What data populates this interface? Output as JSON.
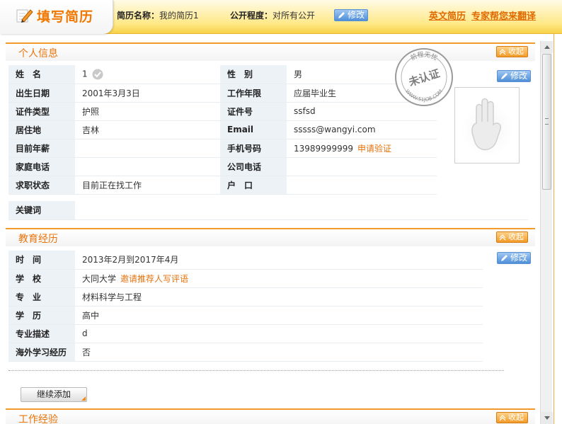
{
  "header": {
    "title": "填写简历",
    "resume_name_label": "简历名称：",
    "resume_name_value": "我的简历1",
    "privacy_label": "公开程度：",
    "privacy_value": "对所有公开",
    "edit_label": "修改",
    "english_resume_link": "英文简历",
    "translate_link": "专家帮您来翻译"
  },
  "personal": {
    "title": "个人信息",
    "collapse_label": "收起",
    "edit_label": "修改",
    "stamp_text_top": "前程无忧",
    "stamp_text_mid": "未认证",
    "stamp_text_bottom": "WWW.51JOB.COM",
    "rows": [
      {
        "l1": "姓　名",
        "v1": "1",
        "l2": "性　别",
        "v2": "男"
      },
      {
        "l1": "出生日期",
        "v1": "2001年3月3日",
        "l2": "工作年限",
        "v2": "应届毕业生"
      },
      {
        "l1": "证件类型",
        "v1": "护照",
        "l2": "证件号",
        "v2": "ssfsd"
      },
      {
        "l1": "居住地",
        "v1": " 吉林",
        "l2": "Email",
        "v2": "sssss@wangyi.com"
      },
      {
        "l1": "目前年薪",
        "v1": "",
        "l2": "手机号码",
        "v2": "13989999999",
        "v2_link": "申请验证"
      },
      {
        "l1": "家庭电话",
        "v1": "",
        "l2": "公司电话",
        "v2": ""
      },
      {
        "l1": "求职状态",
        "v1": "目前正在找工作",
        "l2": "户　口",
        "v2": ""
      },
      {
        "l1": "关键词",
        "v1": ""
      }
    ]
  },
  "education": {
    "title": "教育经历",
    "collapse_label": "收起",
    "edit_label": "修改",
    "rows": [
      {
        "label": "时　间",
        "value": "2013年2月到2017年4月"
      },
      {
        "label": "学　校",
        "value": "大同大学",
        "link": "邀请推荐人写评语"
      },
      {
        "label": "专　业",
        "value": "材料科学与工程"
      },
      {
        "label": "学　历",
        "value": "高中"
      },
      {
        "label": "专业描述",
        "value": "d"
      },
      {
        "label": "海外学习经历",
        "value": "否"
      }
    ],
    "add_more_label": "继续添加"
  },
  "work": {
    "title": "工作经验",
    "collapse_label": "收起"
  },
  "colors": {
    "accent_orange": "#f07800",
    "header_yellow": "#ffe98a",
    "label_bg": "#edf2f7",
    "button_blue": "#4f8fd8"
  },
  "icons": [
    "pencil-icon",
    "edit-icon",
    "collapse-icon",
    "check-icon",
    "hand-photo-placeholder-icon",
    "stamp-icon"
  ]
}
